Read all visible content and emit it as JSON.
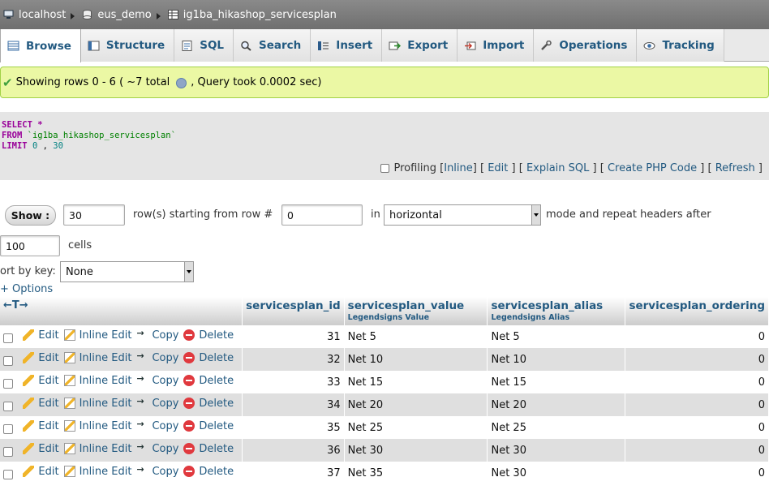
{
  "breadcrumb": [
    {
      "label": "localhost",
      "icon": "server-icon"
    },
    {
      "label": "eus_demo",
      "icon": "database-icon"
    },
    {
      "label": "ig1ba_hikashop_servicesplan",
      "icon": "table-icon"
    }
  ],
  "tabs": [
    {
      "label": "Browse",
      "icon": "browse-icon",
      "active": true
    },
    {
      "label": "Structure",
      "icon": "structure-icon"
    },
    {
      "label": "SQL",
      "icon": "sql-icon"
    },
    {
      "label": "Search",
      "icon": "search-icon"
    },
    {
      "label": "Insert",
      "icon": "insert-icon"
    },
    {
      "label": "Export",
      "icon": "export-icon"
    },
    {
      "label": "Import",
      "icon": "import-icon"
    },
    {
      "label": "Operations",
      "icon": "operations-icon"
    },
    {
      "label": "Tracking",
      "icon": "tracking-icon"
    }
  ],
  "message": {
    "prefix": "Showing rows 0 - 6 ( ~7 total",
    "suffix": ", Query took 0.0002 sec)"
  },
  "sql": {
    "select_kw": "SELECT",
    "select_val": "*",
    "from_kw": "FROM",
    "from_val": "`ig1ba_hikashop_servicesplan`",
    "limit_kw": "LIMIT",
    "limit_start": "0",
    "limit_sep": ",",
    "limit_count": "30"
  },
  "sql_links": {
    "profiling": "Profiling",
    "inline": "Inline",
    "edit": "Edit",
    "explain": "Explain SQL",
    "php": "Create PHP Code",
    "refresh": "Refresh"
  },
  "nav": {
    "show_button": "Show :",
    "rows_value": "30",
    "rows_label": "row(s) starting from row #",
    "start_value": "0",
    "in_label": "in",
    "mode_value": "horizontal",
    "mode_label": "mode and repeat headers after",
    "repeat_value": "100",
    "cells_label": "cells",
    "sort_label": "ort by key:",
    "sort_value": "None",
    "options_link": "+ Options"
  },
  "table": {
    "sort_arrows": "←T→",
    "columns": [
      {
        "name": "servicesplan_id",
        "comment": ""
      },
      {
        "name": "servicesplan_value",
        "comment": "Legendsigns Value"
      },
      {
        "name": "servicesplan_alias",
        "comment": "Legendsigns Alias"
      },
      {
        "name": "servicesplan_ordering",
        "comment": ""
      }
    ],
    "actions": {
      "edit": "Edit",
      "inline_edit": "Inline Edit",
      "copy": "Copy",
      "delete": "Delete"
    },
    "rows": [
      {
        "id": "31",
        "value": "Net 5",
        "alias": "Net 5",
        "ordering": "0"
      },
      {
        "id": "32",
        "value": "Net 10",
        "alias": "Net 10",
        "ordering": "0"
      },
      {
        "id": "33",
        "value": "Net 15",
        "alias": "Net 15",
        "ordering": "0"
      },
      {
        "id": "34",
        "value": "Net 20",
        "alias": "Net 20",
        "ordering": "0"
      },
      {
        "id": "35",
        "value": "Net 25",
        "alias": "Net 25",
        "ordering": "0"
      },
      {
        "id": "36",
        "value": "Net 30",
        "alias": "Net 30",
        "ordering": "0"
      },
      {
        "id": "37",
        "value": "Net 35",
        "alias": "Net 30",
        "ordering": "0"
      }
    ]
  },
  "colors": {
    "link": "#235a81",
    "success_bg": "#ebf8a4",
    "row_alt": "#dfdfdf"
  }
}
